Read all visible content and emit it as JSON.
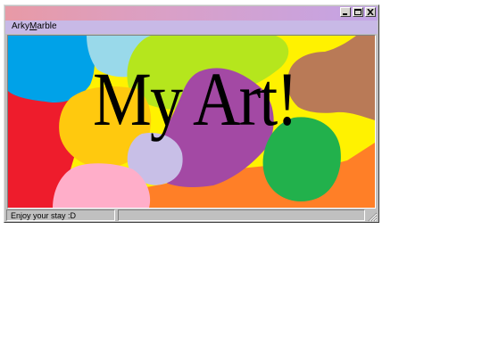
{
  "window": {
    "menu": {
      "title_parts": [
        "Arky",
        "M",
        "arble"
      ]
    },
    "controls": {
      "minimize_icon": "minimize-icon",
      "maximize_icon": "maximize-icon",
      "close_icon": "close-icon"
    }
  },
  "artwork": {
    "title": "My Art!",
    "colors": {
      "red": "#ee1c2c",
      "sky_blue": "#00a2e8",
      "light_blue": "#99d9ea",
      "lime": "#b5e61d",
      "yellow": "#fff200",
      "orange": "#ffc90e",
      "lavender": "#c8bfe7",
      "purple": "#a349a4",
      "pink": "#ffaec9",
      "brown": "#b97a57",
      "green": "#22b14c",
      "dark_orange": "#ff7f27"
    }
  },
  "statusbar": {
    "message": "Enjoy your stay :D",
    "secondary": ""
  }
}
